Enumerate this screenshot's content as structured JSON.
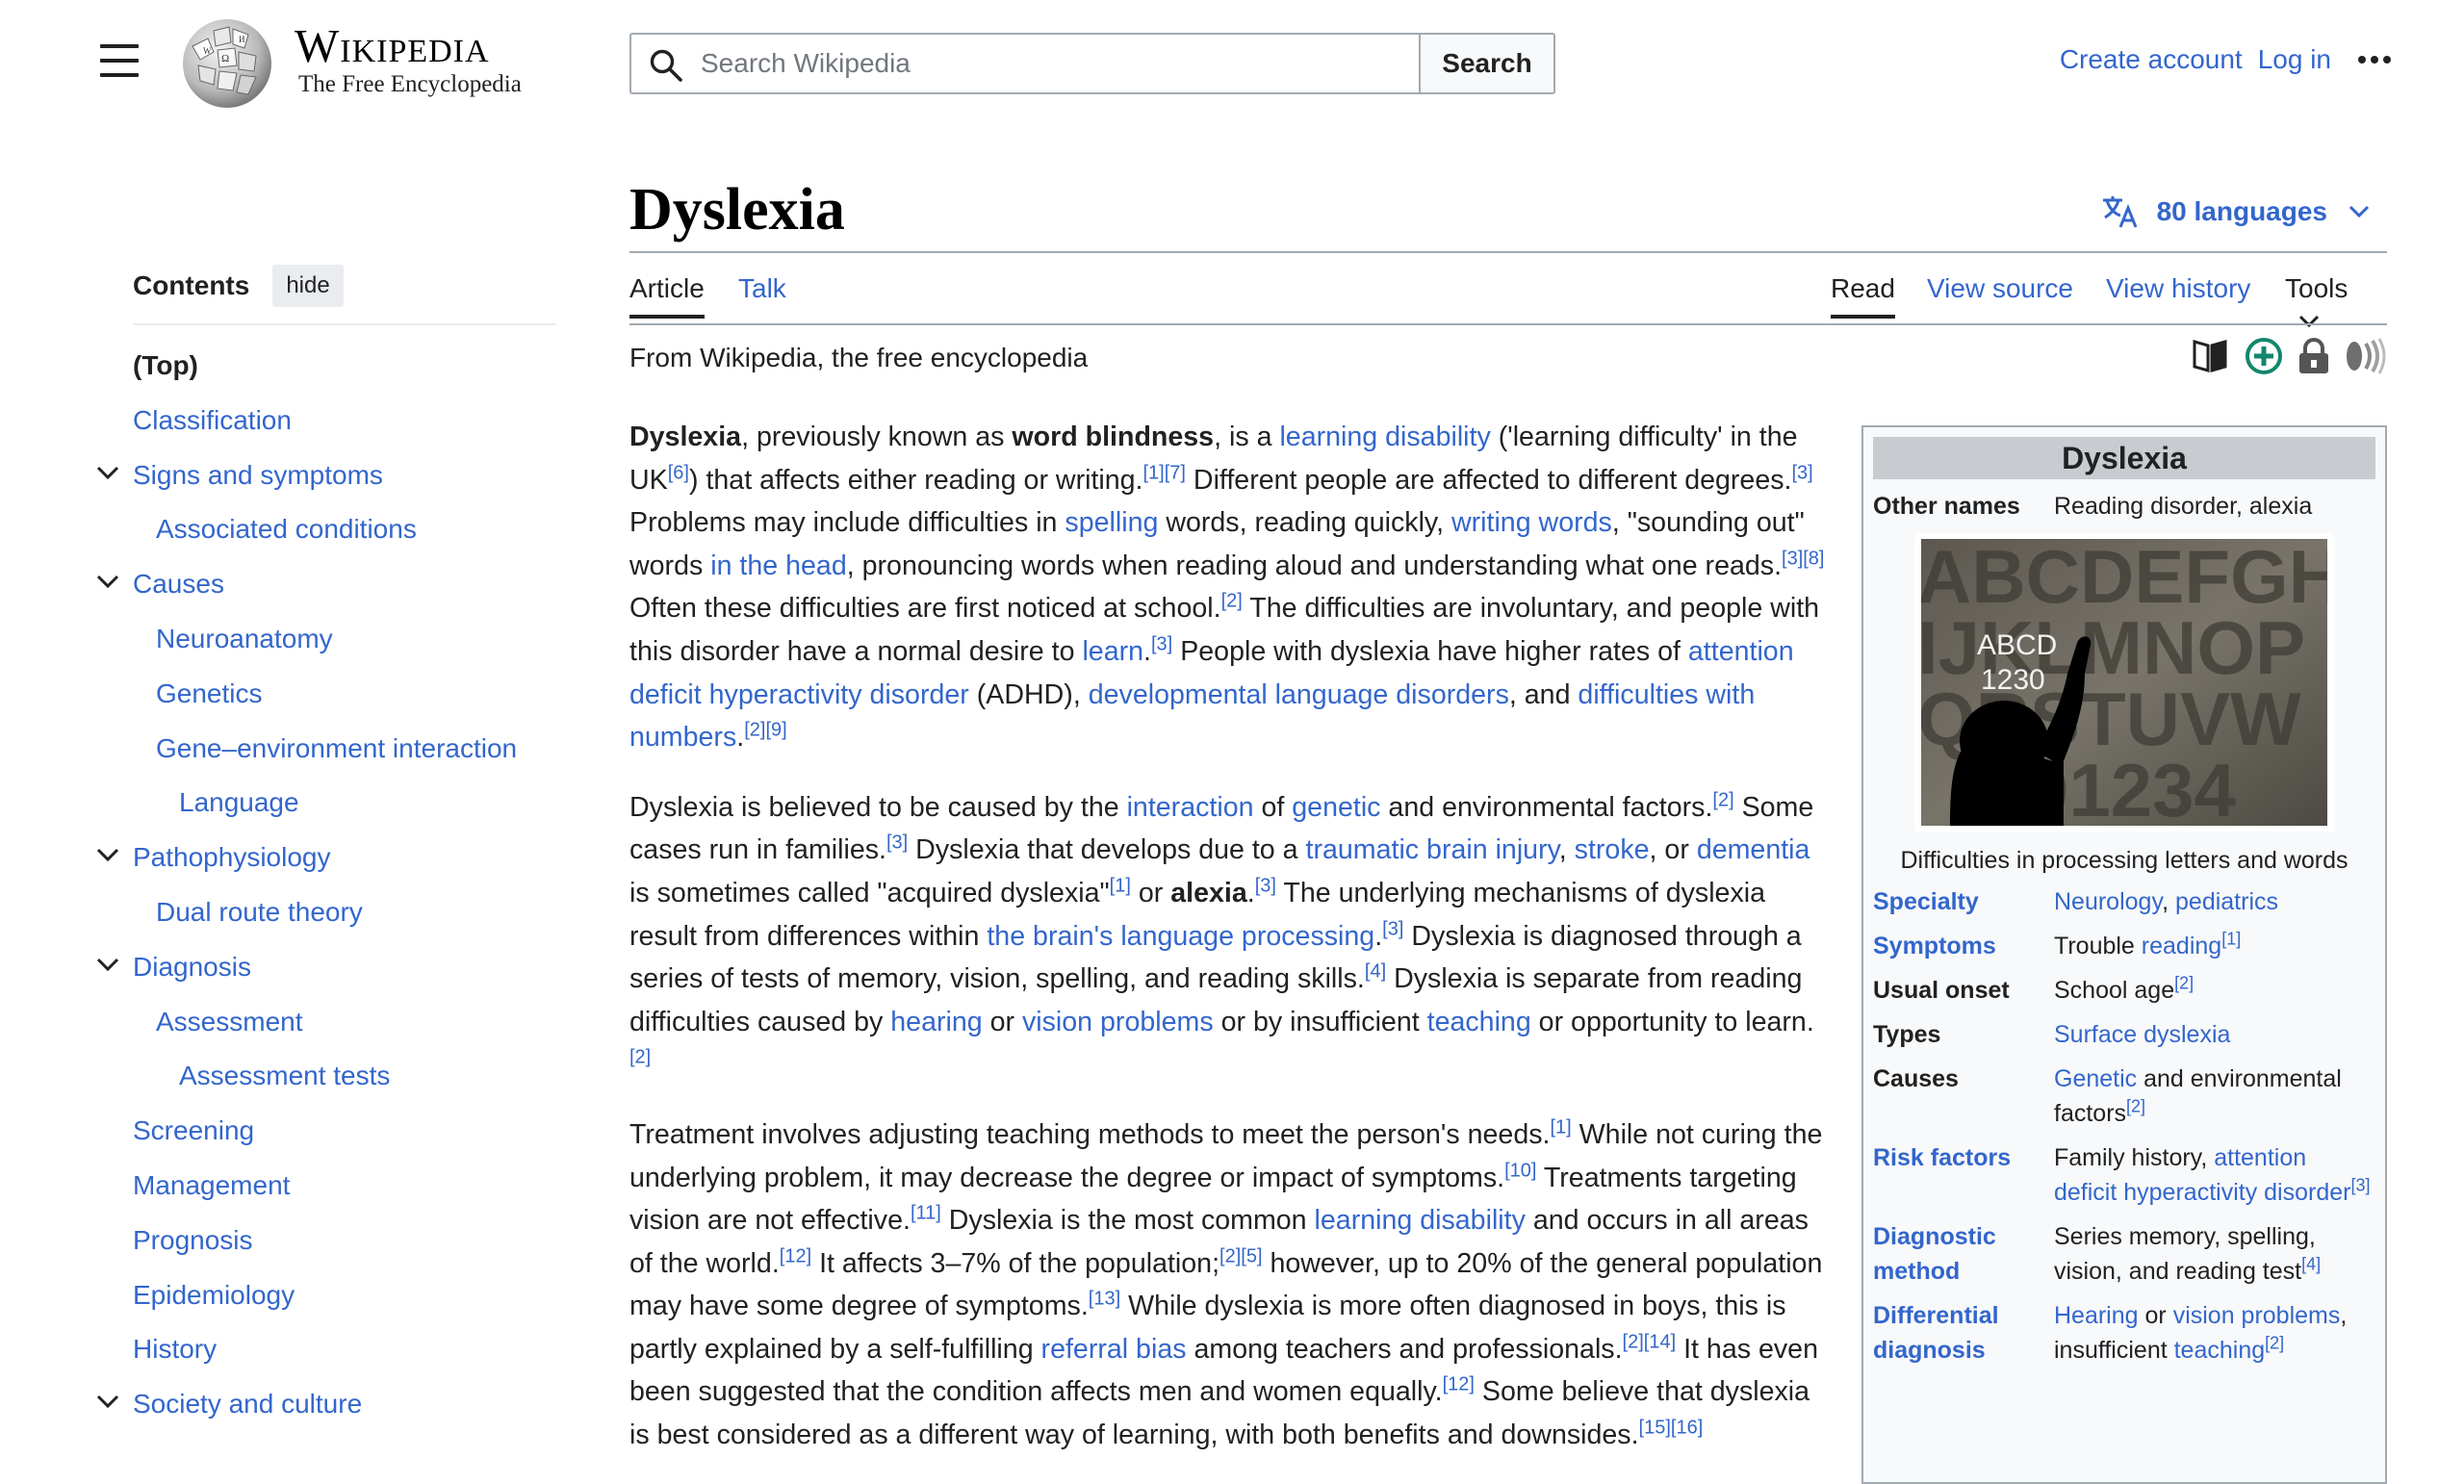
{
  "header": {
    "wordmark_title": "Wikipedia",
    "wordmark_tagline": "The Free Encyclopedia",
    "search_placeholder": "Search Wikipedia",
    "search_button": "Search",
    "create_account": "Create account",
    "log_in": "Log in"
  },
  "toc": {
    "title": "Contents",
    "hide_label": "hide",
    "items": [
      {
        "label": "(Top)",
        "level": 0,
        "collapsible": false
      },
      {
        "label": "Classification",
        "level": 0,
        "collapsible": false
      },
      {
        "label": "Signs and symptoms",
        "level": 0,
        "collapsible": true
      },
      {
        "label": "Associated conditions",
        "level": 1,
        "collapsible": false
      },
      {
        "label": "Causes",
        "level": 0,
        "collapsible": true
      },
      {
        "label": "Neuroanatomy",
        "level": 1,
        "collapsible": false
      },
      {
        "label": "Genetics",
        "level": 1,
        "collapsible": false
      },
      {
        "label": "Gene–environment interaction",
        "level": 1,
        "collapsible": false
      },
      {
        "label": "Language",
        "level": 2,
        "collapsible": false
      },
      {
        "label": "Pathophysiology",
        "level": 0,
        "collapsible": true
      },
      {
        "label": "Dual route theory",
        "level": 1,
        "collapsible": false
      },
      {
        "label": "Diagnosis",
        "level": 0,
        "collapsible": true
      },
      {
        "label": "Assessment",
        "level": 1,
        "collapsible": false
      },
      {
        "label": "Assessment tests",
        "level": 2,
        "collapsible": false
      },
      {
        "label": "Screening",
        "level": 0,
        "collapsible": false
      },
      {
        "label": "Management",
        "level": 0,
        "collapsible": false
      },
      {
        "label": "Prognosis",
        "level": 0,
        "collapsible": false
      },
      {
        "label": "Epidemiology",
        "level": 0,
        "collapsible": false
      },
      {
        "label": "History",
        "level": 0,
        "collapsible": false
      },
      {
        "label": "Society and culture",
        "level": 0,
        "collapsible": true
      }
    ]
  },
  "article": {
    "title": "Dyslexia",
    "languages": "80 languages",
    "tabs": {
      "article": "Article",
      "talk": "Talk",
      "read": "Read",
      "view_source": "View source",
      "view_history": "View history",
      "tools": "Tools"
    },
    "tagline": "From Wikipedia, the free encyclopedia",
    "paragraphs": [
      [
        {
          "b": "Dyslexia"
        },
        {
          "t": ", previously known as "
        },
        {
          "b": "word blindness"
        },
        {
          "t": ", is a "
        },
        {
          "a": "learning disability"
        },
        {
          "t": " ('learning difficulty' in the UK"
        },
        {
          "s": "[6]"
        },
        {
          "t": ") that affects either reading or writing."
        },
        {
          "s": "[1][7]"
        },
        {
          "t": " Different people are affected to different degrees."
        },
        {
          "s": "[3]"
        },
        {
          "t": " Problems may include difficulties in "
        },
        {
          "a": "spelling"
        },
        {
          "t": " words, reading quickly, "
        },
        {
          "a": "writing words"
        },
        {
          "t": ", \"sounding out\" words "
        },
        {
          "a": "in the head"
        },
        {
          "t": ", pronouncing words when reading aloud and understanding what one reads."
        },
        {
          "s": "[3][8]"
        },
        {
          "t": " Often these difficulties are first noticed at school."
        },
        {
          "s": "[2]"
        },
        {
          "t": " The difficulties are involuntary, and people with this disorder have a normal desire to "
        },
        {
          "a": "learn"
        },
        {
          "t": "."
        },
        {
          "s": "[3]"
        },
        {
          "t": " People with dyslexia have higher rates of "
        },
        {
          "a": "attention deficit hyperactivity disorder"
        },
        {
          "t": " (ADHD), "
        },
        {
          "a": "developmental language disorders"
        },
        {
          "t": ", and "
        },
        {
          "a": "difficulties with numbers"
        },
        {
          "t": "."
        },
        {
          "s": "[2][9]"
        }
      ],
      [
        {
          "t": "Dyslexia is believed to be caused by the "
        },
        {
          "a": "interaction"
        },
        {
          "t": " of "
        },
        {
          "a": "genetic"
        },
        {
          "t": " and environmental factors."
        },
        {
          "s": "[2]"
        },
        {
          "t": " Some cases run in families."
        },
        {
          "s": "[3]"
        },
        {
          "t": " Dyslexia that develops due to a "
        },
        {
          "a": "traumatic brain injury"
        },
        {
          "t": ", "
        },
        {
          "a": "stroke"
        },
        {
          "t": ", or "
        },
        {
          "a": "dementia"
        },
        {
          "t": " is sometimes called \"acquired dyslexia\""
        },
        {
          "s": "[1]"
        },
        {
          "t": " or "
        },
        {
          "b": "alexia"
        },
        {
          "t": "."
        },
        {
          "s": "[3]"
        },
        {
          "t": " The underlying mechanisms of dyslexia result from differences within "
        },
        {
          "a": "the brain's language processing"
        },
        {
          "t": "."
        },
        {
          "s": "[3]"
        },
        {
          "t": " Dyslexia is diagnosed through a series of tests of memory, vision, spelling, and reading skills."
        },
        {
          "s": "[4]"
        },
        {
          "t": " Dyslexia is separate from reading difficulties caused by "
        },
        {
          "a": "hearing"
        },
        {
          "t": " or "
        },
        {
          "a": "vision problems"
        },
        {
          "t": " or by insufficient "
        },
        {
          "a": "teaching"
        },
        {
          "t": " or opportunity to learn."
        },
        {
          "s": "[2]"
        }
      ],
      [
        {
          "t": "Treatment involves adjusting teaching methods to meet the person's needs."
        },
        {
          "s": "[1]"
        },
        {
          "t": " While not curing the underlying problem, it may decrease the degree or impact of symptoms."
        },
        {
          "s": "[10]"
        },
        {
          "t": " Treatments targeting vision are not effective."
        },
        {
          "s": "[11]"
        },
        {
          "t": " Dyslexia is the most common "
        },
        {
          "a": "learning disability"
        },
        {
          "t": " and occurs in all areas of the world."
        },
        {
          "s": "[12]"
        },
        {
          "t": " It affects 3–7% of the population;"
        },
        {
          "s": "[2][5]"
        },
        {
          "t": " however, up to 20% of the general population may have some degree of symptoms."
        },
        {
          "s": "[13]"
        },
        {
          "t": " While dyslexia is more often diagnosed in boys, this is partly explained by a self-fulfilling "
        },
        {
          "a": "referral bias"
        },
        {
          "t": " among teachers and professionals."
        },
        {
          "s": "[2][14]"
        },
        {
          "t": " It has even been suggested that the condition affects men and women equally."
        },
        {
          "s": "[12]"
        },
        {
          "t": " Some believe that dyslexia is best considered as a different way of learning, with both benefits and downsides."
        },
        {
          "s": "[15][16]"
        }
      ]
    ]
  },
  "infobox": {
    "title": "Dyslexia",
    "other_names_label": "Other names",
    "other_names_value": "Reading disorder, alexia",
    "image_caption": "Difficulties in processing letters and words",
    "image_letters_row1": "ABCDEFGH",
    "image_letters_row2": "IJKLMNOP",
    "image_letters_row3": "QRSTUVW",
    "image_letters_row4": "01234",
    "image_chalk_1": "ABCD",
    "image_chalk_2": "1230",
    "rows": [
      {
        "label": "Specialty",
        "label_link": true,
        "value": [
          {
            "a": "Neurology"
          },
          {
            "t": ", "
          },
          {
            "a": "pediatrics"
          }
        ]
      },
      {
        "label": "Symptoms",
        "label_link": true,
        "value": [
          {
            "t": "Trouble "
          },
          {
            "a": "reading"
          },
          {
            "s": "[1]"
          }
        ]
      },
      {
        "label": "Usual onset",
        "label_link": false,
        "value": [
          {
            "t": "School age"
          },
          {
            "s": "[2]"
          }
        ]
      },
      {
        "label": "Types",
        "label_link": false,
        "value": [
          {
            "a": "Surface dyslexia"
          }
        ]
      },
      {
        "label": "Causes",
        "label_link": false,
        "value": [
          {
            "a": "Genetic"
          },
          {
            "t": " and environmental factors"
          },
          {
            "s": "[2]"
          }
        ]
      },
      {
        "label": "Risk factors",
        "label_link": true,
        "value": [
          {
            "t": "Family history, "
          },
          {
            "a": "attention deficit hyperactivity disorder"
          },
          {
            "s": "[3]"
          }
        ]
      },
      {
        "label": "Diagnostic method",
        "label_link": true,
        "value": [
          {
            "t": "Series memory, spelling, vision, and reading test"
          },
          {
            "s": "[4]"
          }
        ]
      },
      {
        "label": "Differential diagnosis",
        "label_link": true,
        "value": [
          {
            "a": "Hearing"
          },
          {
            "t": " or "
          },
          {
            "a": "vision problems"
          },
          {
            "t": ", insufficient "
          },
          {
            "a": "teaching"
          },
          {
            "s": "[2]"
          }
        ]
      }
    ]
  }
}
